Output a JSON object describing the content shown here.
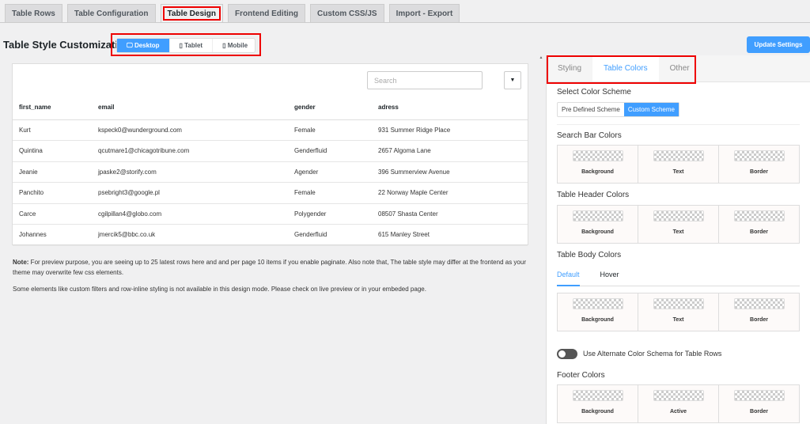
{
  "top_tabs": [
    "Table Rows",
    "Table Configuration",
    "Table Design",
    "Frontend Editing",
    "Custom CSS/JS",
    "Import - Export"
  ],
  "page_title": "Table Style Customization",
  "devices": [
    "Desktop",
    "Tablet",
    "Mobile"
  ],
  "update_label": "Update Settings",
  "table": {
    "search_placeholder": "Search",
    "columns": [
      "first_name",
      "email",
      "gender",
      "adress"
    ],
    "rows": [
      [
        "Kurt",
        "kspeck0@wunderground.com",
        "Female",
        "931 Summer Ridge Place"
      ],
      [
        "Quintina",
        "qcutmare1@chicagotribune.com",
        "Genderfluid",
        "2657 Algoma Lane"
      ],
      [
        "Jeanie",
        "jpaske2@storify.com",
        "Agender",
        "396 Summerview Avenue"
      ],
      [
        "Panchito",
        "psebright3@google.pl",
        "Female",
        "22 Norway Maple Center"
      ],
      [
        "Carce",
        "cgilpillan4@globo.com",
        "Polygender",
        "08507 Shasta Center"
      ],
      [
        "Johannes",
        "jmercik5@bbc.co.uk",
        "Genderfluid",
        "615 Manley Street"
      ]
    ]
  },
  "note": {
    "bold": "Note:",
    "text": " For preview purpose, you are seeing up to 25 latest rows here and and per page 10 items if you enable paginate. Also note that, The table style may differ at the frontend as your theme may overwrite few css elements.",
    "text2": "Some elements like custom filters and row-inline styling is not available in this design mode. Please check on live preview or in your embeded page."
  },
  "right": {
    "tabs": [
      "Styling",
      "Table Colors",
      "Other"
    ],
    "scheme_title": "Select Color Scheme",
    "scheme_options": [
      "Pre Defined Scheme",
      "Custom Scheme"
    ],
    "search_bar": "Search Bar Colors",
    "header": "Table Header Colors",
    "body": "Table Body Colors",
    "body_tabs": [
      "Default",
      "Hover"
    ],
    "alt_toggle": "Use Alternate Color Schema for Table Rows",
    "footer": "Footer Colors",
    "labels": [
      "Background",
      "Text",
      "Border"
    ],
    "footer_labels": [
      "Background",
      "Active",
      "Border"
    ]
  }
}
